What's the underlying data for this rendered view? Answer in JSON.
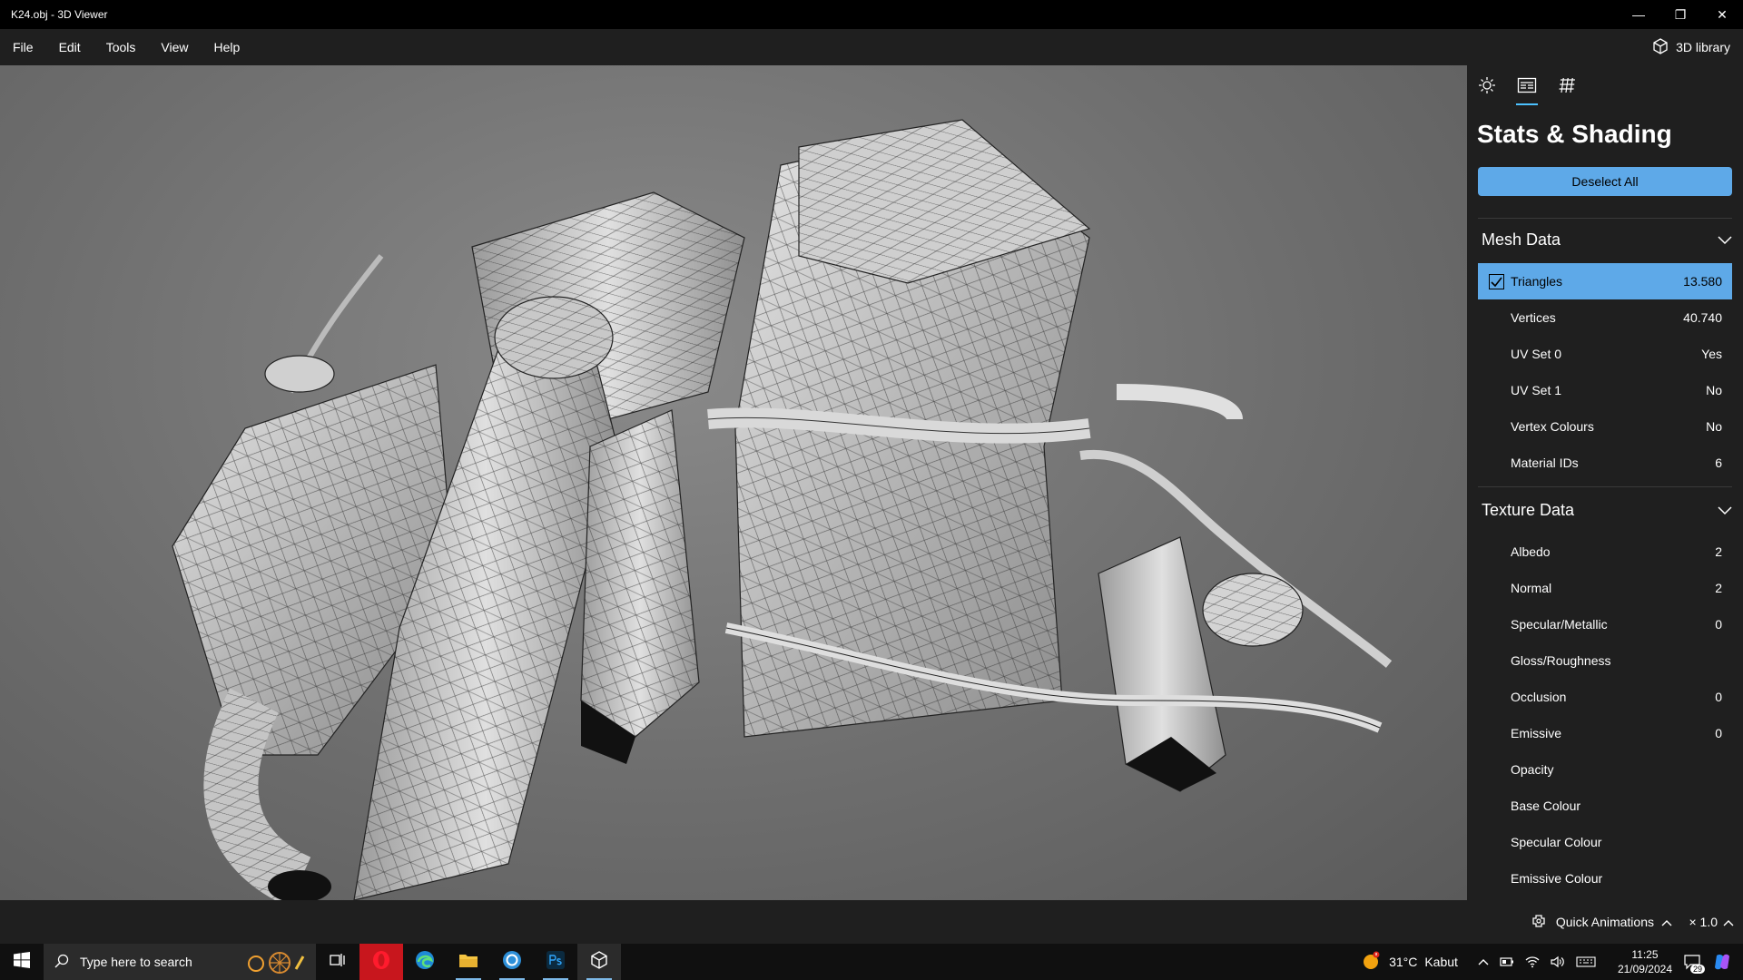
{
  "window": {
    "title": "K24.obj - 3D Viewer",
    "minimize": "—",
    "restore": "❐",
    "close": "✕"
  },
  "menu": [
    "File",
    "Edit",
    "Tools",
    "View",
    "Help"
  ],
  "library_button": "3D library",
  "panel": {
    "title": "Stats & Shading",
    "deselect_label": "Deselect All",
    "mesh_section": "Mesh Data",
    "mesh_rows": [
      {
        "label": "Triangles",
        "value": "13.580",
        "selected": true
      },
      {
        "label": "Vertices",
        "value": "40.740"
      },
      {
        "label": "UV Set 0",
        "value": "Yes"
      },
      {
        "label": "UV Set 1",
        "value": "No"
      },
      {
        "label": "Vertex Colours",
        "value": "No"
      },
      {
        "label": "Material IDs",
        "value": "6"
      }
    ],
    "texture_section": "Texture Data",
    "texture_rows": [
      {
        "label": "Albedo",
        "value": "2"
      },
      {
        "label": "Normal",
        "value": "2"
      },
      {
        "label": "Specular/Metallic",
        "value": "0"
      },
      {
        "label": "Gloss/Roughness",
        "value": ""
      },
      {
        "label": "Occlusion",
        "value": "0"
      },
      {
        "label": "Emissive",
        "value": "0"
      },
      {
        "label": "Opacity",
        "value": ""
      },
      {
        "label": "Base Colour",
        "value": ""
      },
      {
        "label": "Specular Colour",
        "value": ""
      },
      {
        "label": "Emissive Colour",
        "value": ""
      }
    ]
  },
  "bottom": {
    "quick_animations": "Quick Animations",
    "zoom": "× 1.0"
  },
  "taskbar": {
    "search_placeholder": "Type here to search",
    "weather_temp": "31°C",
    "weather_loc": "Kabut",
    "time": "11:25",
    "date": "21/09/2024",
    "notifications": "29"
  },
  "colors": {
    "accent": "#5ea9e8",
    "panel_bg": "#1f1f1f",
    "viewport_bg": "#6e6e6e"
  }
}
